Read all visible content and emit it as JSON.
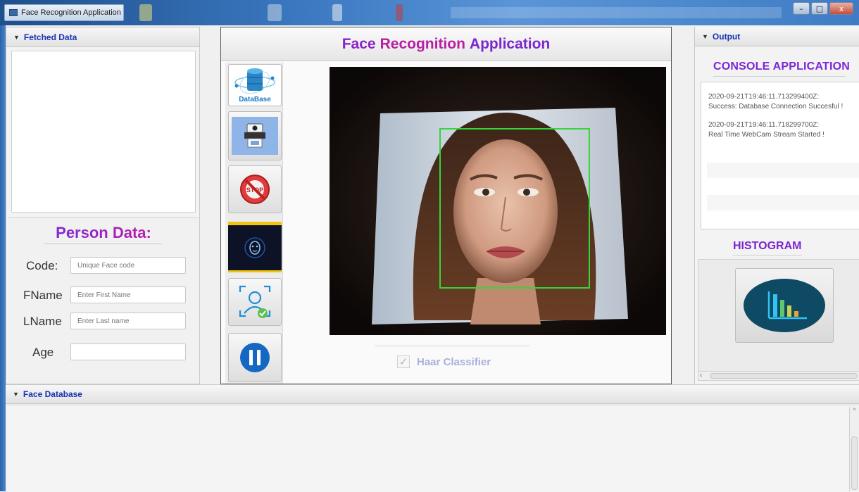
{
  "window": {
    "title": "Face Recognition Application",
    "controls": {
      "minimize": "–",
      "maximize": "□",
      "close": "x"
    }
  },
  "left_panel": {
    "header": "Fetched Data",
    "person_section": {
      "title": "Person Data:",
      "fields": [
        {
          "label": "Code:",
          "placeholder": "Unique Face code",
          "value": ""
        },
        {
          "label": "FName",
          "placeholder": "Enter First Name",
          "value": ""
        },
        {
          "label": "LName",
          "placeholder": "Enter Last name",
          "value": ""
        },
        {
          "label": "Age",
          "placeholder": "",
          "value": ""
        }
      ]
    }
  },
  "center_panel": {
    "title_words": [
      "Face",
      "Recognition",
      "Application"
    ],
    "toolbar": [
      {
        "name": "database-button",
        "icon": "database-icon",
        "label": "DataBase"
      },
      {
        "name": "capture-button",
        "icon": "camera-printer-icon",
        "label": ""
      },
      {
        "name": "stop-button",
        "icon": "stop-sign-icon",
        "label": "STOP"
      },
      {
        "name": "face-scan-button",
        "icon": "face-scan-icon",
        "label": ""
      },
      {
        "name": "recognize-button",
        "icon": "face-recognition-icon",
        "label": ""
      },
      {
        "name": "pause-button",
        "icon": "pause-icon",
        "label": ""
      }
    ],
    "classifier": {
      "label": "Haar Classifier",
      "checked": true
    }
  },
  "right_panel": {
    "header": "Output",
    "console_title": "CONSOLE APPLICATION",
    "console_logs": [
      {
        "timestamp": "2020-09-21T19:46:11.713299400Z:",
        "message": "Success: Database Connection Succesful !"
      },
      {
        "timestamp": "2020-09-21T19:46:11.718299700Z:",
        "message": " Real Time WebCam Stream Started !"
      }
    ],
    "histogram_title": "HISTOGRAM",
    "hscroll_arrow": "‹"
  },
  "bottom_panel": {
    "header": "Face Database",
    "vscroll_arrow": "^"
  },
  "colors": {
    "accent_purple": "#7c26d6",
    "accent_magenta": "#b81fa3",
    "header_blue": "#1733b5",
    "detection_box": "#35d43a"
  }
}
